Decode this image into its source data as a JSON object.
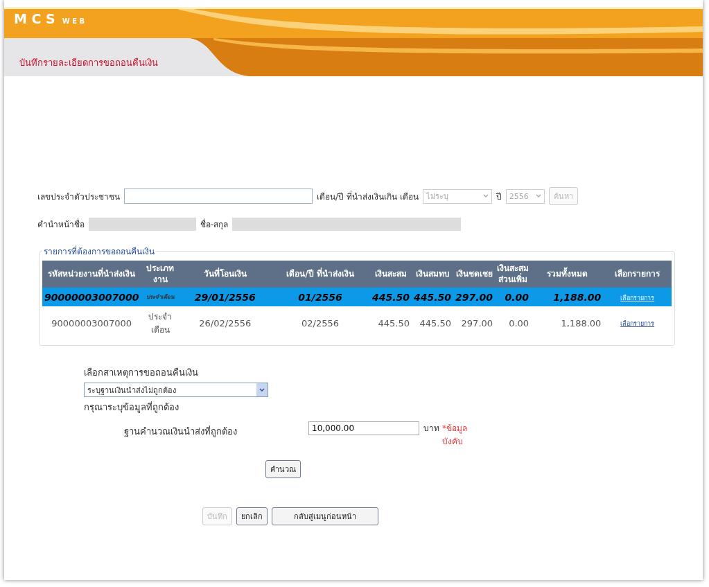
{
  "header": {
    "logo": "M C S",
    "logo_sub": "W E B",
    "title": "บันทึกรายละเอียดการขอถอนคืนเงิน"
  },
  "search": {
    "id_label": "เลขประจำตัวประชาชน",
    "period_label": "เดือน/ปี ที่นำส่งเงินเกิน เดือน",
    "month": "ไม่ระบุ",
    "year_label": "ปี",
    "year": "2556",
    "search_button": "ค้นหา",
    "search_disabled": true,
    "prefix_label": "คำนำหน้าชื่อ",
    "name_label": "ชื่อ-สกุล"
  },
  "table": {
    "legend": "รายการที่ต้องการขอถอนคืนเงิน",
    "columns": [
      "รหัสหน่วยงานที่นำส่งเงิน",
      "ประเภทงาน",
      "วันที่โอนเงิน",
      "เดือน/ปี ที่นำส่งเงิน",
      "เงินสะสม",
      "เงินสมทบ",
      "เงินชดเชย",
      "เงินสะสมส่วนเพิ่ม",
      "รวมทั้งหมด",
      "เลือกรายการ"
    ],
    "rows": [
      {
        "selected": true,
        "cells": [
          "90000003007000",
          "ประจำเดือน",
          "29/01/2556",
          "01/2556",
          "445.50",
          "445.50",
          "297.00",
          "0.00",
          "1,188.00"
        ],
        "link": "เลือกรายการ"
      },
      {
        "selected": false,
        "cells": [
          "90000003007000",
          "ประจำเดือน",
          "26/02/2556",
          "02/2556",
          "445.50",
          "445.50",
          "297.00",
          "0.00",
          "1,188.00"
        ],
        "link": "เลือกรายการ"
      }
    ]
  },
  "reason": {
    "label": "เลือกสาเหตุการขอถอนคืนเงิน",
    "value": "ระบุฐานเงินนำส่งไม่ถูกต้อง",
    "hint": "กรุณาระบุข้อมูลที่ถูกต้อง",
    "base_label": "ฐานคำนวณเงินนำส่งที่ถูกต้อง",
    "base_value": "10,000.00",
    "unit": "บาท",
    "required": "*ข้อมูลบังคับ",
    "calc_button": "คำนวณ"
  },
  "buttons": [
    {
      "label": "บันทึก",
      "disabled": true
    },
    {
      "label": "ยกเลิก",
      "disabled": false
    },
    {
      "label": "กลับสู่เมนูก่อนหน้า",
      "disabled": false
    }
  ]
}
